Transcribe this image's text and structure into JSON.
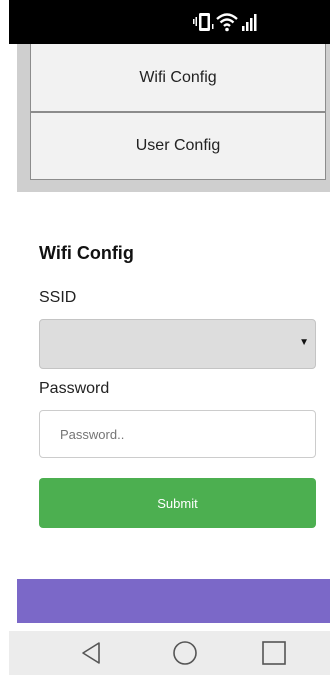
{
  "colors": {
    "status_bar": "#000000",
    "menu_panel": "#cfcfcf",
    "submit_bg": "#4caf50",
    "purple_bar": "#7b68c8",
    "nav_bar": "#ececec"
  },
  "status_bar": {
    "icons": [
      "vibrate-icon",
      "wifi-icon",
      "signal-icon"
    ]
  },
  "menu": {
    "items": [
      {
        "label": "Wifi Config"
      },
      {
        "label": "User Config"
      }
    ]
  },
  "form": {
    "title": "Wifi Config",
    "ssid_label": "SSID",
    "ssid_value": "",
    "password_label": "Password",
    "password_placeholder": "Password..",
    "password_value": "",
    "submit_label": "Submit"
  },
  "nav": {
    "icons": [
      "back-icon",
      "home-icon",
      "recents-icon"
    ]
  }
}
